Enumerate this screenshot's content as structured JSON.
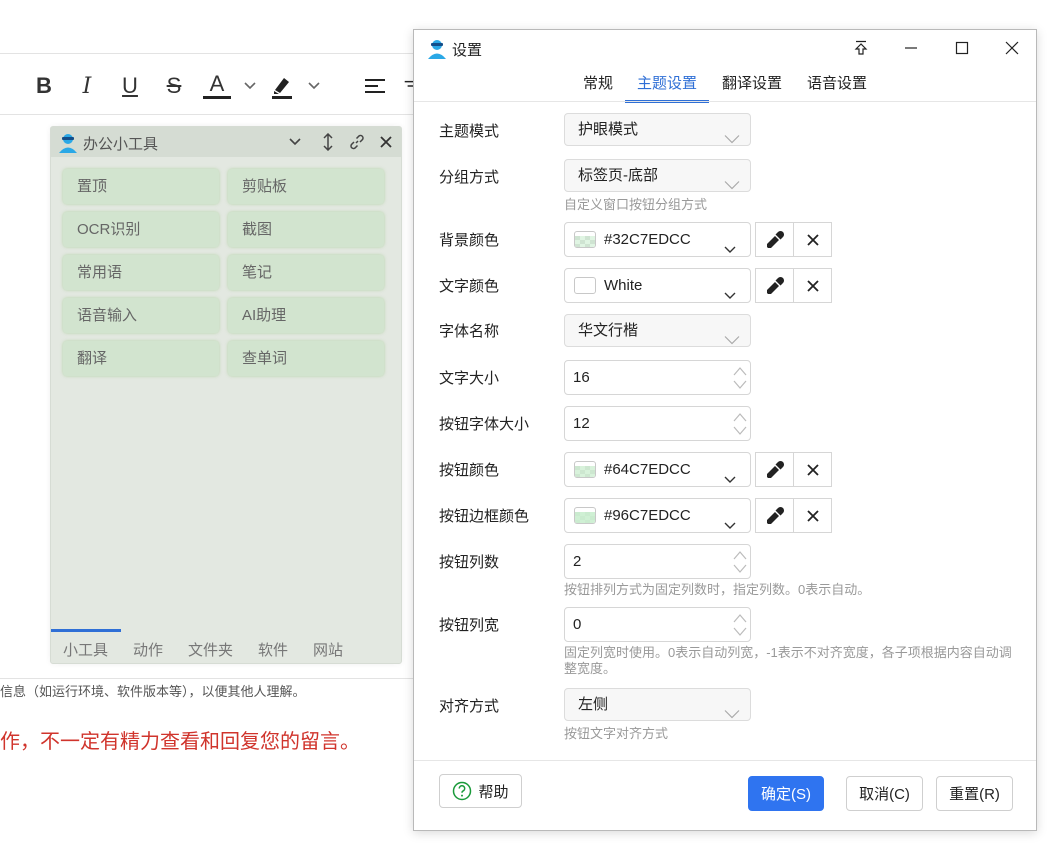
{
  "editor": {
    "toolbar": {
      "bold": "B",
      "italic": "I",
      "underline": "U",
      "strike": "S",
      "font_color": "A"
    },
    "info_text": "信息（如运行环境、软件版本等），以便其他人理解。",
    "warning_text": "作，不一定有精力查看和回复您的留言。"
  },
  "tool_panel": {
    "title": "办公小工具",
    "buttons": [
      "置顶",
      "剪贴板",
      "OCR识别",
      "截图",
      "常用语",
      "笔记",
      "语音输入",
      "AI助理",
      "翻译",
      "查单词"
    ],
    "tabs": [
      "小工具",
      "动作",
      "文件夹",
      "软件",
      "网站"
    ],
    "active_tab": 0,
    "colors": {
      "background": "#E3E8E1",
      "button": "#D2E4CF",
      "accent": "#2F6FD6"
    }
  },
  "dialog": {
    "title": "设置",
    "tabs": [
      "常规",
      "主题设置",
      "翻译设置",
      "语音设置"
    ],
    "active_tab": 1,
    "rows": {
      "theme_mode": {
        "label": "主题模式",
        "value": "护眼模式"
      },
      "group_mode": {
        "label": "分组方式",
        "value": "标签页-底部",
        "hint": "自定义窗口按钮分组方式"
      },
      "bg_color": {
        "label": "背景颜色",
        "value": "#32C7EDCC",
        "swatch": "#C7EDCC"
      },
      "text_color": {
        "label": "文字颜色",
        "value": "White",
        "swatch": "#FFFFFF"
      },
      "font_name": {
        "label": "字体名称",
        "value": "华文行楷"
      },
      "text_size": {
        "label": "文字大小",
        "value": "16"
      },
      "btn_font_size": {
        "label": "按钮字体大小",
        "value": "12"
      },
      "btn_color": {
        "label": "按钮颜色",
        "value": "#64C7EDCC",
        "swatch": "#C7EDCC"
      },
      "btn_border_color": {
        "label": "按钮边框颜色",
        "value": "#96C7EDCC",
        "swatch": "#C7EDCC"
      },
      "btn_columns": {
        "label": "按钮列数",
        "value": "2",
        "hint": "按钮排列方式为固定列数时，指定列数。0表示自动。"
      },
      "btn_col_width": {
        "label": "按钮列宽",
        "value": "0",
        "hint": "固定列宽时使用。0表示自动列宽，-1表示不对齐宽度，各子项根据内容自动调整宽度。"
      },
      "align": {
        "label": "对齐方式",
        "value": "左侧",
        "hint": "按钮文字对齐方式"
      }
    },
    "footer": {
      "help": "帮助",
      "ok": "确定(S)",
      "cancel": "取消(C)",
      "reset": "重置(R)"
    },
    "colors": {
      "primary": "#2F74F0",
      "tab_active": "#2F6FD6"
    }
  }
}
